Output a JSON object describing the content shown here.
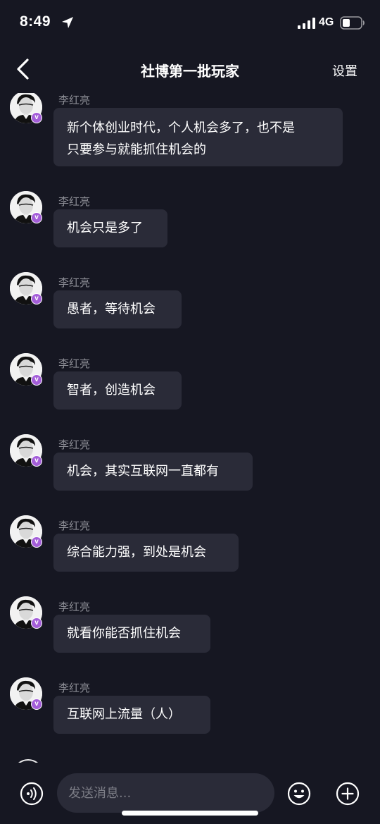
{
  "status_bar": {
    "time": "8:49",
    "network": "4G",
    "icons": [
      "location-arrow-icon",
      "signal-bars-icon",
      "battery-icon"
    ]
  },
  "nav": {
    "back_icon": "chevron-left-icon",
    "title": "社博第一批玩家",
    "settings_label": "设置"
  },
  "messages": [
    {
      "sender": "李红亮",
      "text_lines": [
        "新个体创业时代，个人机会多了，也不是",
        "只要参与就能抓住机会的"
      ]
    },
    {
      "sender": "李红亮",
      "text_lines": [
        "机会只是多了"
      ]
    },
    {
      "sender": "李红亮",
      "text_lines": [
        "愚者，等待机会"
      ]
    },
    {
      "sender": "李红亮",
      "text_lines": [
        "智者，创造机会"
      ]
    },
    {
      "sender": "李红亮",
      "text_lines": [
        "机会，其实互联网一直都有"
      ]
    },
    {
      "sender": "李红亮",
      "text_lines": [
        "综合能力强，到处是机会"
      ]
    },
    {
      "sender": "李红亮",
      "text_lines": [
        "就看你能否抓住机会"
      ]
    },
    {
      "sender": "李红亮",
      "text_lines": [
        "互联网上流量（人）"
      ]
    }
  ],
  "avatar_badge": "v",
  "input": {
    "placeholder": "发送消息...",
    "icons": [
      "voice-icon",
      "emoji-icon",
      "plus-icon"
    ]
  },
  "colors": {
    "background": "#161722",
    "bubble": "#2a2b38",
    "sender_text": "#8b8c94",
    "badge": "#a45ed9"
  }
}
